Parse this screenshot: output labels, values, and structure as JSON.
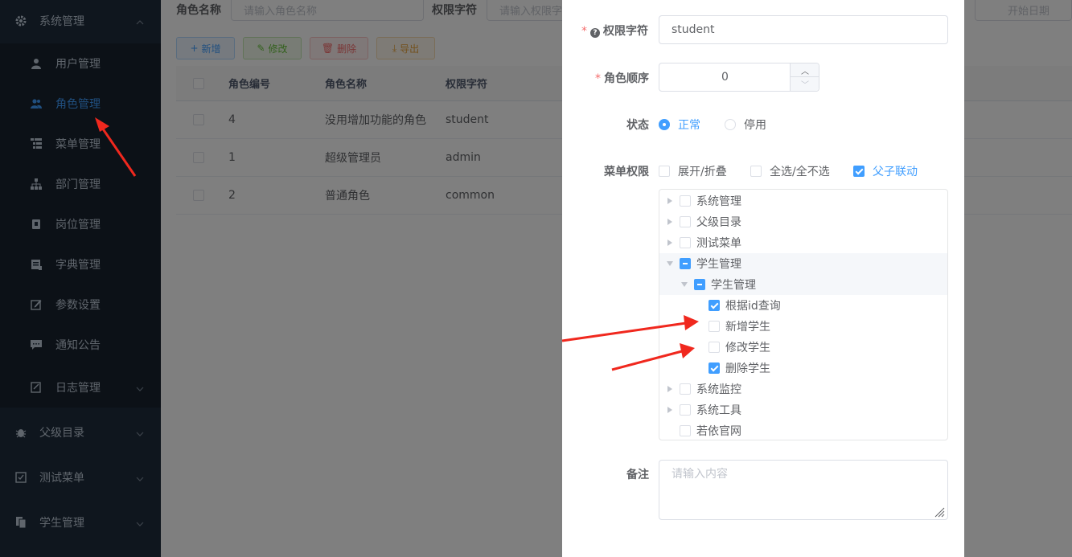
{
  "sidebar": {
    "group_system": "系统管理",
    "items": [
      {
        "label": "用户管理",
        "icon": "user-icon"
      },
      {
        "label": "角色管理",
        "icon": "peoples-icon"
      },
      {
        "label": "菜单管理",
        "icon": "tree-table-icon"
      },
      {
        "label": "部门管理",
        "icon": "tree-icon"
      },
      {
        "label": "岗位管理",
        "icon": "post-icon"
      },
      {
        "label": "字典管理",
        "icon": "dict-icon"
      },
      {
        "label": "参数设置",
        "icon": "edit-icon"
      },
      {
        "label": "通知公告",
        "icon": "message-icon"
      },
      {
        "label": "日志管理",
        "icon": "log-icon"
      }
    ],
    "groups": [
      {
        "label": "父级目录",
        "icon": "bug-icon"
      },
      {
        "label": "测试菜单",
        "icon": "checkbox-icon"
      },
      {
        "label": "学生管理",
        "icon": "documentation-icon"
      }
    ],
    "active_color": "#409eff"
  },
  "search": {
    "role_name_label": "角色名称",
    "role_name_placeholder": "请输入角色名称",
    "perm_label": "权限字符",
    "perm_placeholder": "请输入权限字符",
    "date_placeholder": "开始日期"
  },
  "toolbar": {
    "add": "新增",
    "edit": "修改",
    "delete": "删除",
    "export": "导出"
  },
  "table": {
    "headers": [
      "角色编号",
      "角色名称",
      "权限字符"
    ],
    "rows": [
      {
        "id": "4",
        "name": "没用增加功能的角色",
        "key": "student"
      },
      {
        "id": "1",
        "name": "超级管理员",
        "key": "admin"
      },
      {
        "id": "2",
        "name": "普通角色",
        "key": "common"
      }
    ]
  },
  "dialog": {
    "perm_label": "权限字符",
    "perm_value": "student",
    "order_label": "角色顺序",
    "order_value": "0",
    "status_label": "状态",
    "status_normal": "正常",
    "status_disabled": "停用",
    "menu_perm_label": "菜单权限",
    "expand_label": "展开/折叠",
    "select_all_label": "全选/全不选",
    "linkage_label": "父子联动",
    "remark_label": "备注",
    "remark_placeholder": "请输入内容",
    "tree": [
      "系统管理",
      "父级目录",
      "测试菜单",
      "学生管理",
      "学生管理",
      "根据id查询",
      "新增学生",
      "修改学生",
      "删除学生",
      "系统监控",
      "系统工具",
      "若依官网"
    ]
  }
}
